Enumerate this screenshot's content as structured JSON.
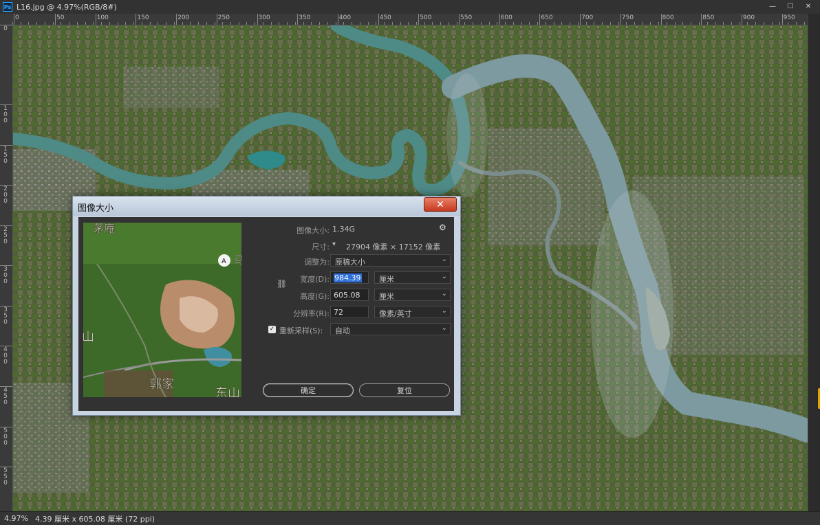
{
  "app": {
    "doc_tab": "L16.jpg @ 4.97%(RGB/8#)",
    "icon": "photoshop-icon",
    "win_controls": [
      "—",
      "☐",
      "✕"
    ]
  },
  "rulers": {
    "top": [
      "0",
      "50",
      "100",
      "150",
      "200",
      "250",
      "300",
      "350",
      "400",
      "450",
      "500",
      "550",
      "600",
      "650",
      "700",
      "750",
      "800",
      "850",
      "900",
      "950"
    ],
    "left": [
      "0",
      "100",
      "150",
      "200",
      "250",
      "300",
      "350",
      "400",
      "450",
      "500",
      "550"
    ]
  },
  "status": {
    "zoom": "4.97%",
    "doc_info": "4.39 厘米 x 605.08 厘米 (72 ppi)"
  },
  "dialog": {
    "title": "图像大小",
    "close_label": "✕",
    "image_size_label": "图像大小:",
    "image_size_value": "1.34G",
    "dimensions_label": "尺寸:",
    "dimensions_value": "27904 像素  ×  17152 像素",
    "fit_to_label": "调整为:",
    "fit_to_value": "原稿大小",
    "width_label": "宽度(D):",
    "width_value": "984.39",
    "width_unit": "厘米",
    "height_label": "高度(G):",
    "height_value": "605.08",
    "height_unit": "厘米",
    "resolution_label": "分辨率(R):",
    "resolution_value": "72",
    "resolution_unit": "像素/英寸",
    "resample_label": "重新采样(S):",
    "resample_value": "自动",
    "resample_checked": "✓",
    "ok_label": "确定",
    "reset_label": "复位",
    "preview_labels": [
      "茅庵",
      "马",
      "郭家",
      "东山",
      "山"
    ]
  },
  "colors": {
    "accent": "#2d6fd6",
    "close": "#c6391f",
    "dialog_bg": "#323232"
  }
}
